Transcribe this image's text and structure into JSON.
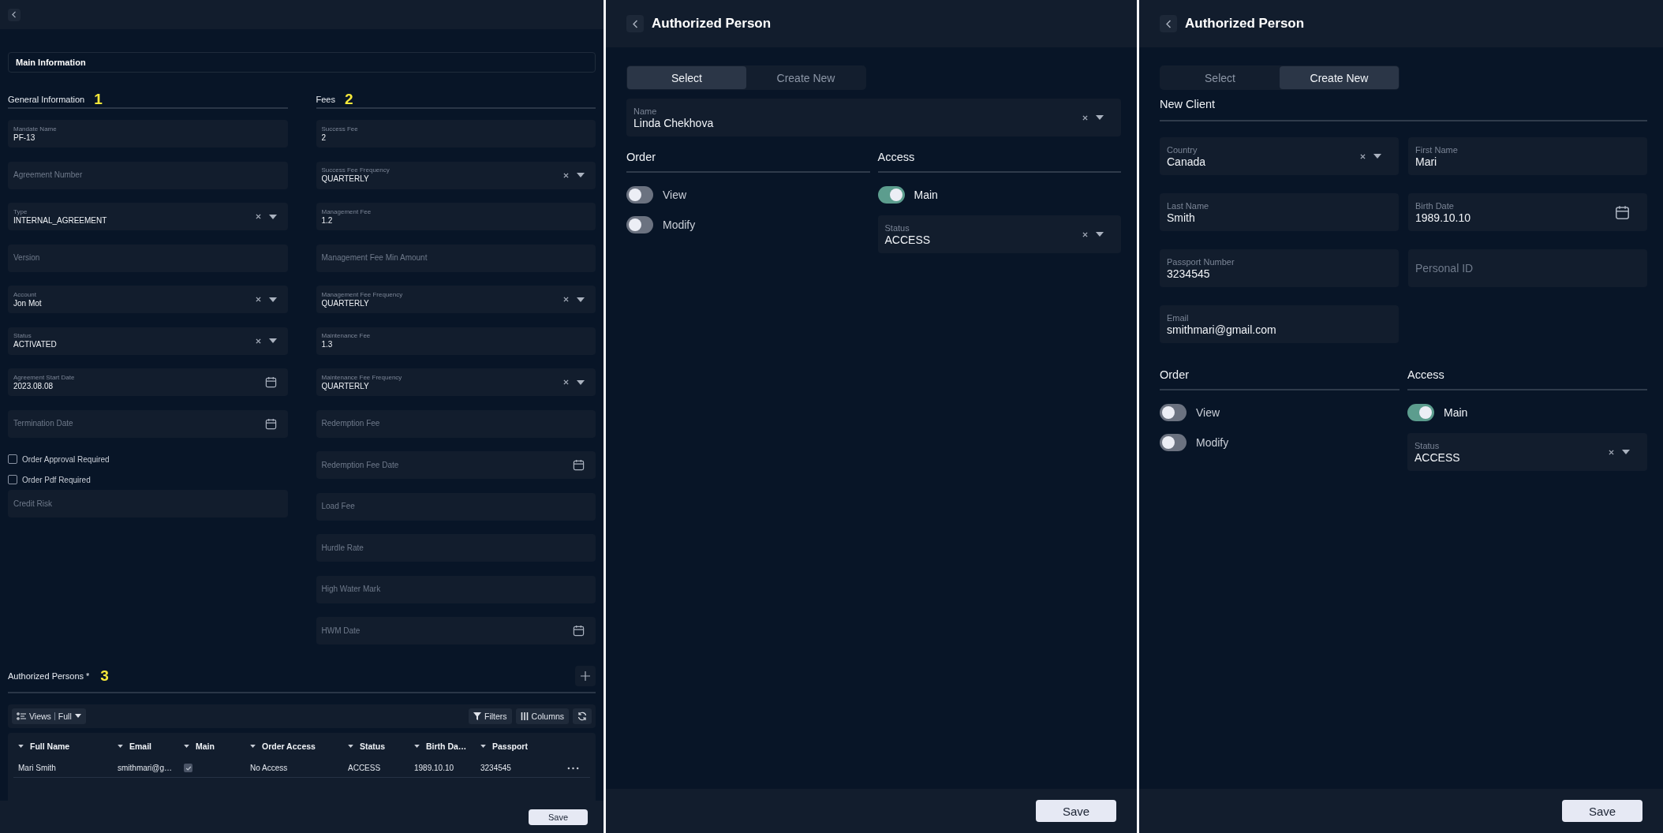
{
  "left_panel": {
    "main_tab": "Main Information",
    "general": {
      "title": "General Information",
      "annotation": "1",
      "items": [
        {
          "kind": "text",
          "label": "Mandate Name",
          "value": "PF-13"
        },
        {
          "kind": "text",
          "placeholder": "Agreement Number"
        },
        {
          "kind": "select",
          "label": "Type",
          "value": "INTERNAL_AGREEMENT"
        },
        {
          "kind": "text",
          "placeholder": "Version"
        },
        {
          "kind": "select",
          "label": "Account",
          "value": "Jon Mot"
        },
        {
          "kind": "select",
          "label": "Status",
          "value": "ACTIVATED"
        },
        {
          "kind": "date",
          "label": "Agreement Start Date",
          "value": "2023.08.08"
        },
        {
          "kind": "date",
          "placeholder": "Termination Date"
        },
        {
          "kind": "checkbox",
          "label": "Order Approval Required",
          "checked": false
        },
        {
          "kind": "checkbox",
          "label": "Order Pdf Required",
          "checked": false
        },
        {
          "kind": "text",
          "placeholder": "Credit Risk"
        }
      ]
    },
    "fees": {
      "title": "Fees",
      "annotation": "2",
      "items": [
        {
          "kind": "text",
          "label": "Success Fee",
          "value": "2"
        },
        {
          "kind": "select",
          "label": "Success Fee Frequency",
          "value": "QUARTERLY"
        },
        {
          "kind": "text",
          "label": "Management Fee",
          "value": "1.2"
        },
        {
          "kind": "text",
          "placeholder": "Management Fee Min Amount"
        },
        {
          "kind": "select",
          "label": "Management Fee Frequency",
          "value": "QUARTERLY"
        },
        {
          "kind": "text",
          "label": "Maintenance Fee",
          "value": "1.3"
        },
        {
          "kind": "select",
          "label": "Maintenance Fee Frequency",
          "value": "QUARTERLY"
        },
        {
          "kind": "text",
          "placeholder": "Redemption Fee"
        },
        {
          "kind": "date",
          "placeholder": "Redemption Fee Date"
        },
        {
          "kind": "text",
          "placeholder": "Load Fee"
        },
        {
          "kind": "text",
          "placeholder": "Hurdle Rate"
        },
        {
          "kind": "text",
          "placeholder": "High Water Mark"
        },
        {
          "kind": "date",
          "placeholder": "HWM Date"
        }
      ]
    },
    "authorized_persons": {
      "title": "Authorized Persons *",
      "annotation": "3",
      "toolbar": {
        "views_label": "Views",
        "views_value": "Full",
        "filters": "Filters",
        "columns": "Columns"
      },
      "table": {
        "columns": [
          "Full Name",
          "Email",
          "Main",
          "Order Access",
          "Status",
          "Birth Da…",
          "Passport"
        ],
        "rows": [
          {
            "cells": [
              {
                "kind": "text",
                "text": "Mari Smith"
              },
              {
                "kind": "text",
                "text": "smithmari@g…"
              },
              {
                "kind": "check",
                "checked": true
              },
              {
                "kind": "text",
                "text": "No Access"
              },
              {
                "kind": "text",
                "text": "ACCESS"
              },
              {
                "kind": "text",
                "text": "1989.10.10"
              },
              {
                "kind": "text",
                "text": "3234545"
              }
            ]
          }
        ]
      }
    },
    "save": "Save"
  },
  "select_panel": {
    "title": "Authorized Person",
    "tabs": [
      {
        "label": "Select",
        "selected": true
      },
      {
        "label": "Create New",
        "selected": false
      }
    ],
    "name_field": {
      "kind": "select",
      "label": "Name",
      "value": "Linda Chekhova"
    },
    "order": {
      "title": "Order",
      "toggles": [
        {
          "label": "View",
          "on": false
        },
        {
          "label": "Modify",
          "on": false
        }
      ]
    },
    "access": {
      "title": "Access",
      "toggles": [
        {
          "label": "Main",
          "on": true
        }
      ],
      "status_field": {
        "kind": "select",
        "label": "Status",
        "value": "ACCESS"
      }
    },
    "save": "Save"
  },
  "create_panel": {
    "title": "Authorized Person",
    "tabs": [
      {
        "label": "Select",
        "selected": false
      },
      {
        "label": "Create New",
        "selected": true
      }
    ],
    "section_title": "New Client",
    "fields": [
      {
        "kind": "select",
        "label": "Country",
        "value": "Canada"
      },
      {
        "kind": "text",
        "label": "First Name",
        "value": "Mari"
      },
      {
        "kind": "text",
        "label": "Last Name",
        "value": "Smith"
      },
      {
        "kind": "date",
        "label": "Birth Date",
        "value": "1989.10.10"
      },
      {
        "kind": "text",
        "label": "Passport Number",
        "value": "3234545"
      },
      {
        "kind": "text",
        "placeholder": "Personal ID"
      },
      {
        "kind": "text",
        "label": "Email",
        "value": "smithmari@gmail.com"
      }
    ],
    "order": {
      "title": "Order",
      "toggles": [
        {
          "label": "View",
          "on": false
        },
        {
          "label": "Modify",
          "on": false
        }
      ]
    },
    "access": {
      "title": "Access",
      "toggles": [
        {
          "label": "Main",
          "on": true
        }
      ],
      "status_field": {
        "kind": "select",
        "label": "Status",
        "value": "ACCESS"
      }
    },
    "save": "Save"
  }
}
